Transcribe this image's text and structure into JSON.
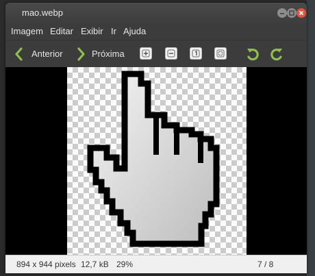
{
  "window": {
    "title": "mao.webp"
  },
  "menu": {
    "items": [
      "Imagem",
      "Editar",
      "Exibir",
      "Ir",
      "Ajuda"
    ]
  },
  "toolbar": {
    "prev_label": "Anterior",
    "next_label": "Próxima",
    "icons": [
      "zoom-in-icon",
      "zoom-out-icon",
      "normal-size-icon",
      "best-fit-icon",
      "rotate-left-icon",
      "rotate-right-icon"
    ]
  },
  "status": {
    "dimensions": "894 x 944 pixels",
    "size": "12,7 kB",
    "zoom": "29%",
    "position": "7 / 8"
  },
  "colors": {
    "arrow_green": "#8fc04a",
    "close_button": "#e0553c",
    "status_bg": "#f0f0f0"
  }
}
